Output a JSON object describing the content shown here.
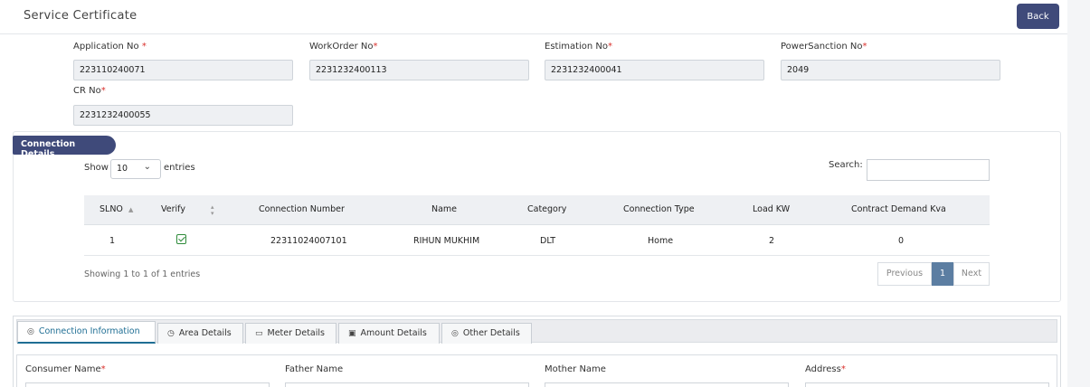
{
  "header": {
    "title": "Service Certificate",
    "back_label": "Back"
  },
  "form": {
    "application_no": {
      "label": "Application No",
      "value": "223110240071"
    },
    "workorder_no": {
      "label": "WorkOrder No",
      "value": "2231232400113"
    },
    "estimation_no": {
      "label": "Estimation No",
      "value": "2231232400041"
    },
    "powersanction_no": {
      "label": "PowerSanction No",
      "value": "2049"
    },
    "cr_no": {
      "label": "CR No",
      "value": "2231232400055"
    },
    "required_mark": "*"
  },
  "connection_details": {
    "section_title": "Connection Details",
    "show_label": "Show",
    "page_size": "10",
    "entries_label": "entries",
    "search_label": "Search:",
    "columns": [
      "SLNO",
      "Verify",
      "Connection Number",
      "Name",
      "Category",
      "Connection Type",
      "Load KW",
      "Contract Demand Kva"
    ],
    "rows": [
      {
        "slno": "1",
        "verified": true,
        "connection_number": "22311024007101",
        "name": "RIHUN MUKHIM",
        "category": "DLT",
        "connection_type": "Home",
        "load_kw": "2",
        "contract_demand_kva": "0"
      }
    ],
    "info": "Showing 1 to 1 of 1 entries",
    "pagination": {
      "previous": "Previous",
      "current": "1",
      "next": "Next"
    }
  },
  "tabs": [
    {
      "label": "Connection Information",
      "icon": "circle-icon",
      "glyph": "◎",
      "active": true
    },
    {
      "label": "Area Details",
      "icon": "clock-icon",
      "glyph": "◷",
      "active": false
    },
    {
      "label": "Meter Details",
      "icon": "meter-icon",
      "glyph": "▭",
      "active": false
    },
    {
      "label": "Amount Details",
      "icon": "image-icon",
      "glyph": "▣",
      "active": false
    },
    {
      "label": "Other Details",
      "icon": "circle-icon",
      "glyph": "◎",
      "active": false
    }
  ],
  "consumer": {
    "consumer_name": "Consumer Name",
    "father_name": "Father Name",
    "mother_name": "Mother Name",
    "address": "Address"
  },
  "colors": {
    "primary": "#3f4a7a",
    "required": "#d9302c",
    "active_page": "#5c7ea2",
    "active_tab": "#1f6e94"
  }
}
